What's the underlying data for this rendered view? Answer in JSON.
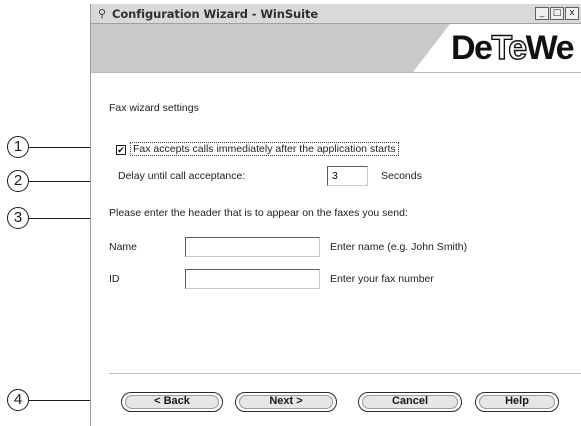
{
  "callouts": [
    "1",
    "2",
    "3",
    "4"
  ],
  "window": {
    "title": "Configuration Wizard - WinSuite",
    "controls": {
      "minimize": "_",
      "restore": "□",
      "close": "x"
    }
  },
  "banner": {
    "logo_pre": "De",
    "logo_mid": "Te",
    "logo_post": "We"
  },
  "section_title": "Fax wizard settings",
  "accept_calls": {
    "checked": true,
    "check_glyph": "✔",
    "label": "Fax accepts calls immediately after the application starts"
  },
  "delay": {
    "label": "Delay until call acceptance:",
    "value": "3",
    "unit": "Seconds"
  },
  "header_prompt": "Please enter the header that is to appear on the faxes you send:",
  "name_field": {
    "label": "Name",
    "value": "",
    "hint": "Enter name (e.g. John Smith)"
  },
  "id_field": {
    "label": "ID",
    "value": "",
    "hint": "Enter your fax number"
  },
  "buttons": {
    "back": "< Back",
    "next": "Next >",
    "cancel": "Cancel",
    "help": "Help"
  }
}
